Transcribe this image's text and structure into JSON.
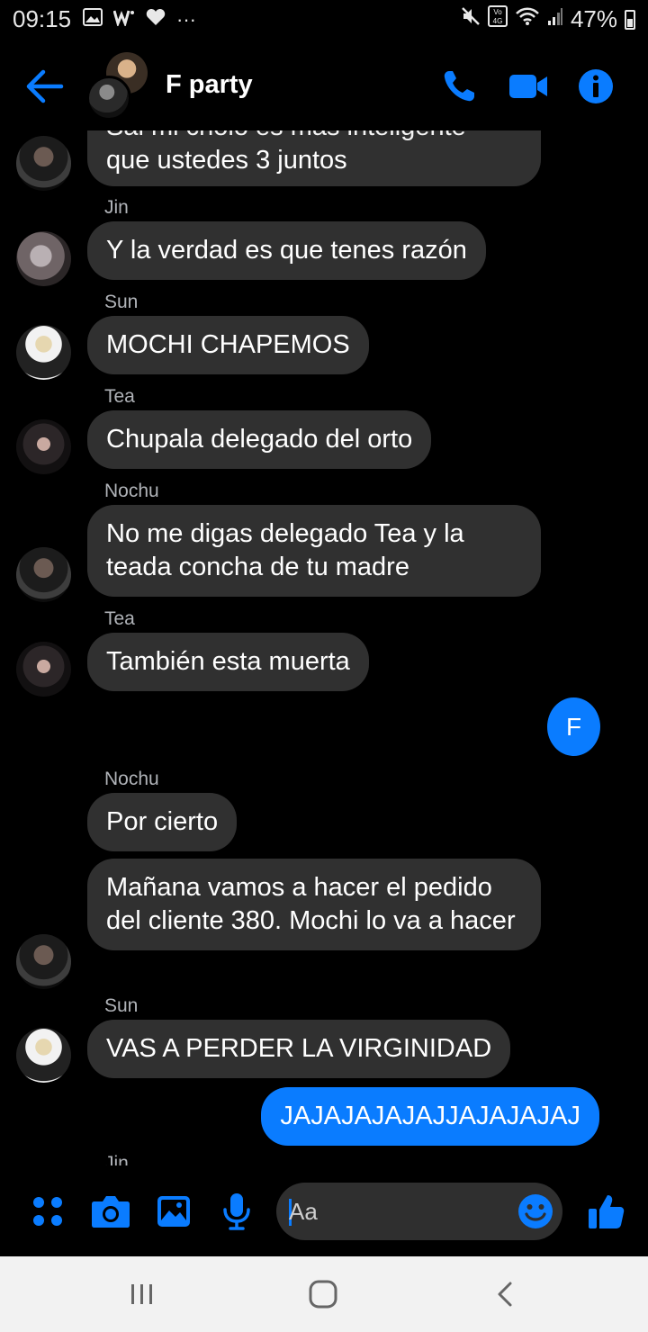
{
  "status_bar": {
    "time": "09:15",
    "dots": "···",
    "battery": "47%",
    "network": "4G",
    "volte": "Vo"
  },
  "header": {
    "title": "F party"
  },
  "messages": [
    {
      "type": "bubble",
      "text": "que ustedes 3 juntos",
      "partial_text": "Sal mi cholo es más inteligente"
    },
    {
      "type": "sender",
      "text": "Jin"
    },
    {
      "type": "bubble",
      "text": "Y la verdad es que tenes razón"
    },
    {
      "type": "sender",
      "text": "Sun"
    },
    {
      "type": "bubble",
      "text": "MOCHI CHAPEMOS"
    },
    {
      "type": "sender",
      "text": "Tea"
    },
    {
      "type": "bubble",
      "text": "Chupala delegado del orto"
    },
    {
      "type": "sender",
      "text": "Nochu"
    },
    {
      "type": "bubble",
      "text": "No me digas delegado Tea y la teada concha de tu madre"
    },
    {
      "type": "sender",
      "text": "Tea"
    },
    {
      "type": "bubble",
      "text": "También esta muerta"
    },
    {
      "type": "sender",
      "text": "Nochu"
    },
    {
      "type": "bubble",
      "text": "Por cierto"
    },
    {
      "type": "bubble",
      "text": "Mañana vamos a hacer el pedido del cliente 380. Mochi lo va a hacer"
    },
    {
      "type": "sender",
      "text": "Sun"
    },
    {
      "type": "bubble",
      "text": "VAS A PERDER LA VIRGINIDAD"
    },
    {
      "type": "bubble",
      "text": "JAJAJAJAJAJJAJAJAJAJ",
      "mine": true
    },
    {
      "type": "sender",
      "text": "Jin"
    }
  ],
  "read_receipt": "F",
  "composer": {
    "placeholder": "Aa"
  },
  "colors": {
    "accent": "#0a7cff",
    "bubble": "#303030",
    "background": "#000000",
    "navbar": "#f2f2f2"
  }
}
